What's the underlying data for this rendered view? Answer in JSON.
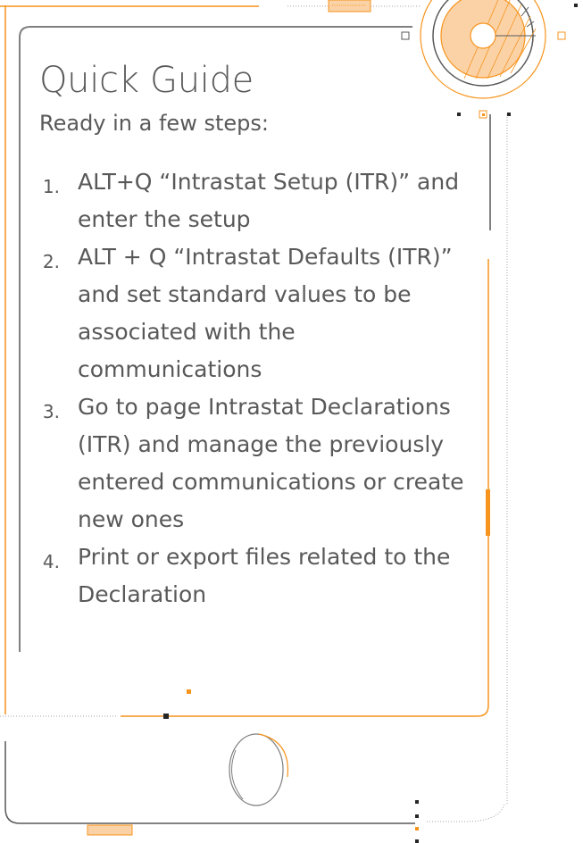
{
  "guide": {
    "title": "Quick Guide",
    "subtitle": "Ready in a few steps:",
    "steps": [
      {
        "number": "1.",
        "text": "ALT+Q “Intrastat Setup (ITR)” and enter the setup"
      },
      {
        "number": "2.",
        "text": "ALT + Q “Intrastat Defaults (ITR)” and set standard values to be associated with the communications"
      },
      {
        "number": "3.",
        "text": "Go to page Intrastat Declarations (ITR) and manage the previously entered communications or create new ones"
      },
      {
        "number": "4.",
        "text": "Print or export files related to the Declaration"
      }
    ]
  },
  "colors": {
    "accent": "#F7941D",
    "accent_light": "#FBD2A6",
    "text": "#595959",
    "frame": "#7F7F7F"
  },
  "icons": {
    "phone_frame": "phone-frame-illustration",
    "circle_badge": "circle-badge-icon",
    "home_button": "home-button-icon"
  }
}
